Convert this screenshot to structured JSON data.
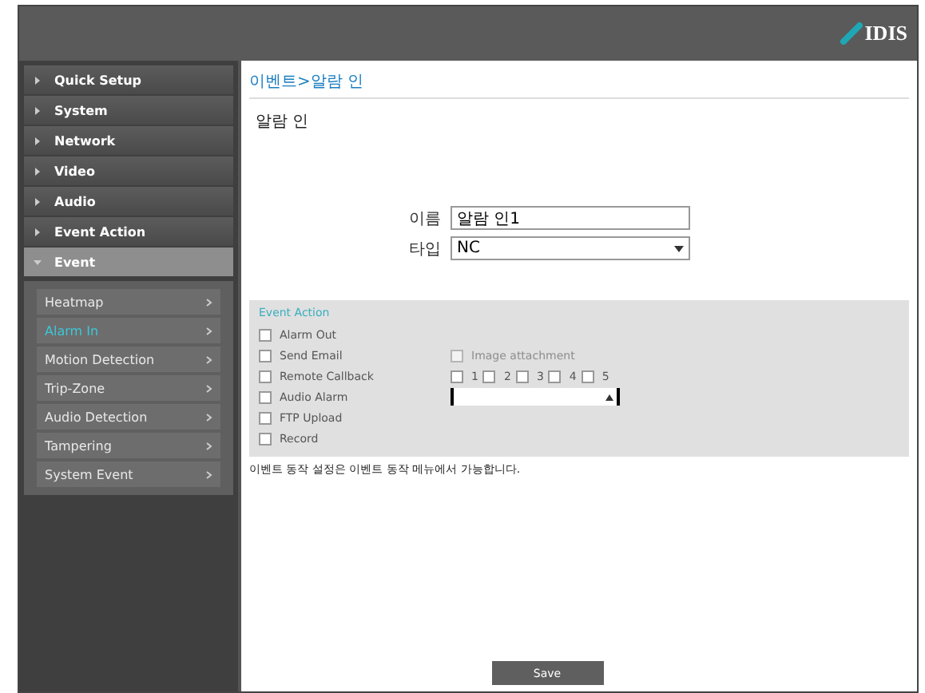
{
  "header": {
    "logo": "IDIS"
  },
  "sidebar": {
    "items": [
      {
        "label": "Quick Setup",
        "expanded": false
      },
      {
        "label": "System",
        "expanded": false
      },
      {
        "label": "Network",
        "expanded": false
      },
      {
        "label": "Video",
        "expanded": false
      },
      {
        "label": "Audio",
        "expanded": false
      },
      {
        "label": "Event Action",
        "expanded": false
      },
      {
        "label": "Event",
        "expanded": true,
        "children": [
          {
            "label": "Heatmap",
            "selected": false
          },
          {
            "label": "Alarm In",
            "selected": true
          },
          {
            "label": "Motion Detection",
            "selected": false
          },
          {
            "label": "Trip-Zone",
            "selected": false
          },
          {
            "label": "Audio Detection",
            "selected": false
          },
          {
            "label": "Tampering",
            "selected": false
          },
          {
            "label": "System Event",
            "selected": false
          }
        ]
      }
    ]
  },
  "content": {
    "breadcrumb": "이벤트>알람 인",
    "title": "알람 인",
    "fields": [
      {
        "kind": "text",
        "label": "이름",
        "value": "알람 인1"
      },
      {
        "kind": "select",
        "label": "타입",
        "value": "NC"
      }
    ],
    "event_action": {
      "title": "Event Action",
      "rows": [
        {
          "label": "Alarm Out",
          "checked": false
        },
        {
          "label": "Send Email",
          "checked": false,
          "extra": {
            "kind": "checkbox",
            "label": "Image attachment",
            "checked": false,
            "disabled": true
          }
        },
        {
          "label": "Remote Callback",
          "checked": false,
          "extra": {
            "kind": "numbers",
            "options": [
              {
                "label": "1",
                "checked": false
              },
              {
                "label": "2",
                "checked": false
              },
              {
                "label": "3",
                "checked": false
              },
              {
                "label": "4",
                "checked": false
              },
              {
                "label": "5",
                "checked": false
              }
            ]
          }
        },
        {
          "label": "Audio Alarm",
          "checked": false,
          "extra": {
            "kind": "select"
          }
        },
        {
          "label": "FTP Upload",
          "checked": false
        },
        {
          "label": "Record",
          "checked": false
        }
      ]
    },
    "note": "이벤트 동작 설정은 이벤트 동작 메뉴에서 가능합니다.",
    "save": "Save"
  }
}
